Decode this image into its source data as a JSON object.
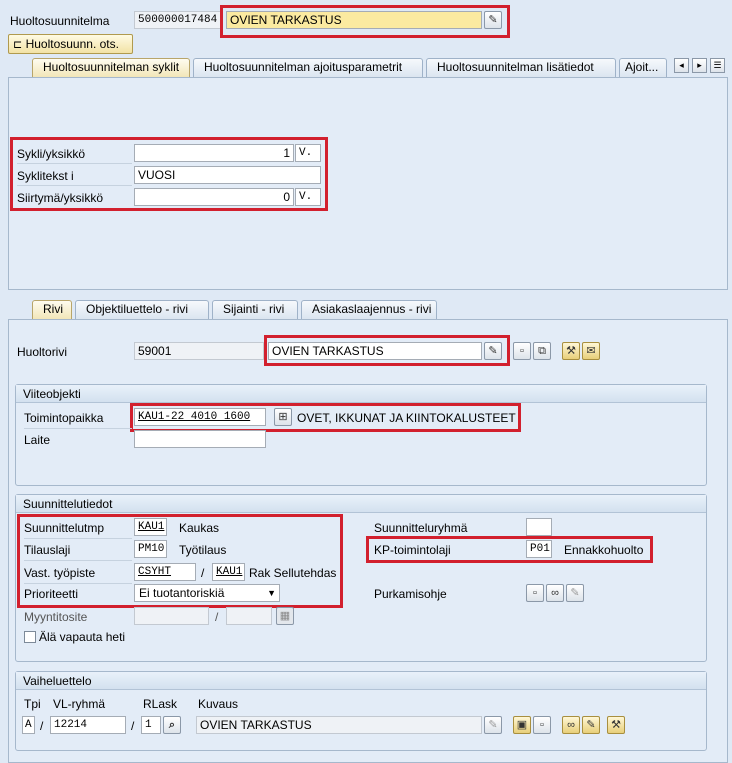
{
  "header": {
    "plan_label": "Huoltosuunnitelma",
    "plan_number": "500000017484",
    "plan_text": "OVIEN TARKASTUS",
    "header_button": "Huoltosuunn. ots."
  },
  "tabs_top": [
    "Huoltosuunnitelman syklit",
    "Huoltosuunnitelman ajoitusparametrit",
    "Huoltosuunnitelman lisätiedot",
    "Ajoit..."
  ],
  "cycle": {
    "cycle_label": "Sykli/yksikkö",
    "cycle_value": "1",
    "cycle_unit": "V.",
    "text_label": "Syklitekst i",
    "text_value": "VUOSI",
    "offset_label": "Siirtymä/yksikkö",
    "offset_value": "0",
    "offset_unit": "V."
  },
  "tabs_bottom": [
    "Rivi",
    "Objektiluettelo - rivi",
    "Sijainti - rivi",
    "Asiakaslaajennus - rivi"
  ],
  "item": {
    "label": "Huoltorivi",
    "number": "59001",
    "text": "OVIEN TARKASTUS"
  },
  "ref_object": {
    "title": "Viiteobjekti",
    "func_loc_label": "Toimintopaikka",
    "func_loc_value": "KAU1-22 4010 1600",
    "func_loc_desc": "OVET, IKKUNAT JA KIINTOKALUSTEET",
    "equipment_label": "Laite",
    "equipment_value": ""
  },
  "planning": {
    "title": "Suunnittelutiedot",
    "plant_label": "Suunnittelutmp",
    "plant_value": "KAU1",
    "plant_desc": "Kaukas",
    "order_type_label": "Tilauslaji",
    "order_type_value": "PM10",
    "order_type_desc": "Työtilaus",
    "workcenter_label": "Vast. työpiste",
    "workcenter_value": "CSYHT",
    "workcenter_plant": "KAU1",
    "workcenter_desc": "Rak Sellutehdas",
    "priority_label": "Prioriteetti",
    "priority_value": "Ei tuotantoriskiä",
    "sales_doc_label": "Myyntitosite",
    "release_label": "Älä vapauta heti",
    "group_label": "Suunnitteluryhmä",
    "group_value": "",
    "activity_label": "KP-toimintolaji",
    "activity_value": "P01",
    "activity_desc": "Ennakkohuolto",
    "assembly_label": "Purkamisohje"
  },
  "task_list": {
    "title": "Vaiheluettelo",
    "col_type": "Tpi",
    "col_group": "VL-ryhmä",
    "col_counter": "RLask",
    "col_desc": "Kuvaus",
    "type_value": "A",
    "group_value": "12214",
    "counter_value": "1",
    "desc_value": "OVIEN TARKASTUS",
    "slash": "/"
  },
  "colors": {
    "highlight": "#d2202e",
    "background": "#dfe9f5",
    "active_tab": "#f2e6b8"
  }
}
